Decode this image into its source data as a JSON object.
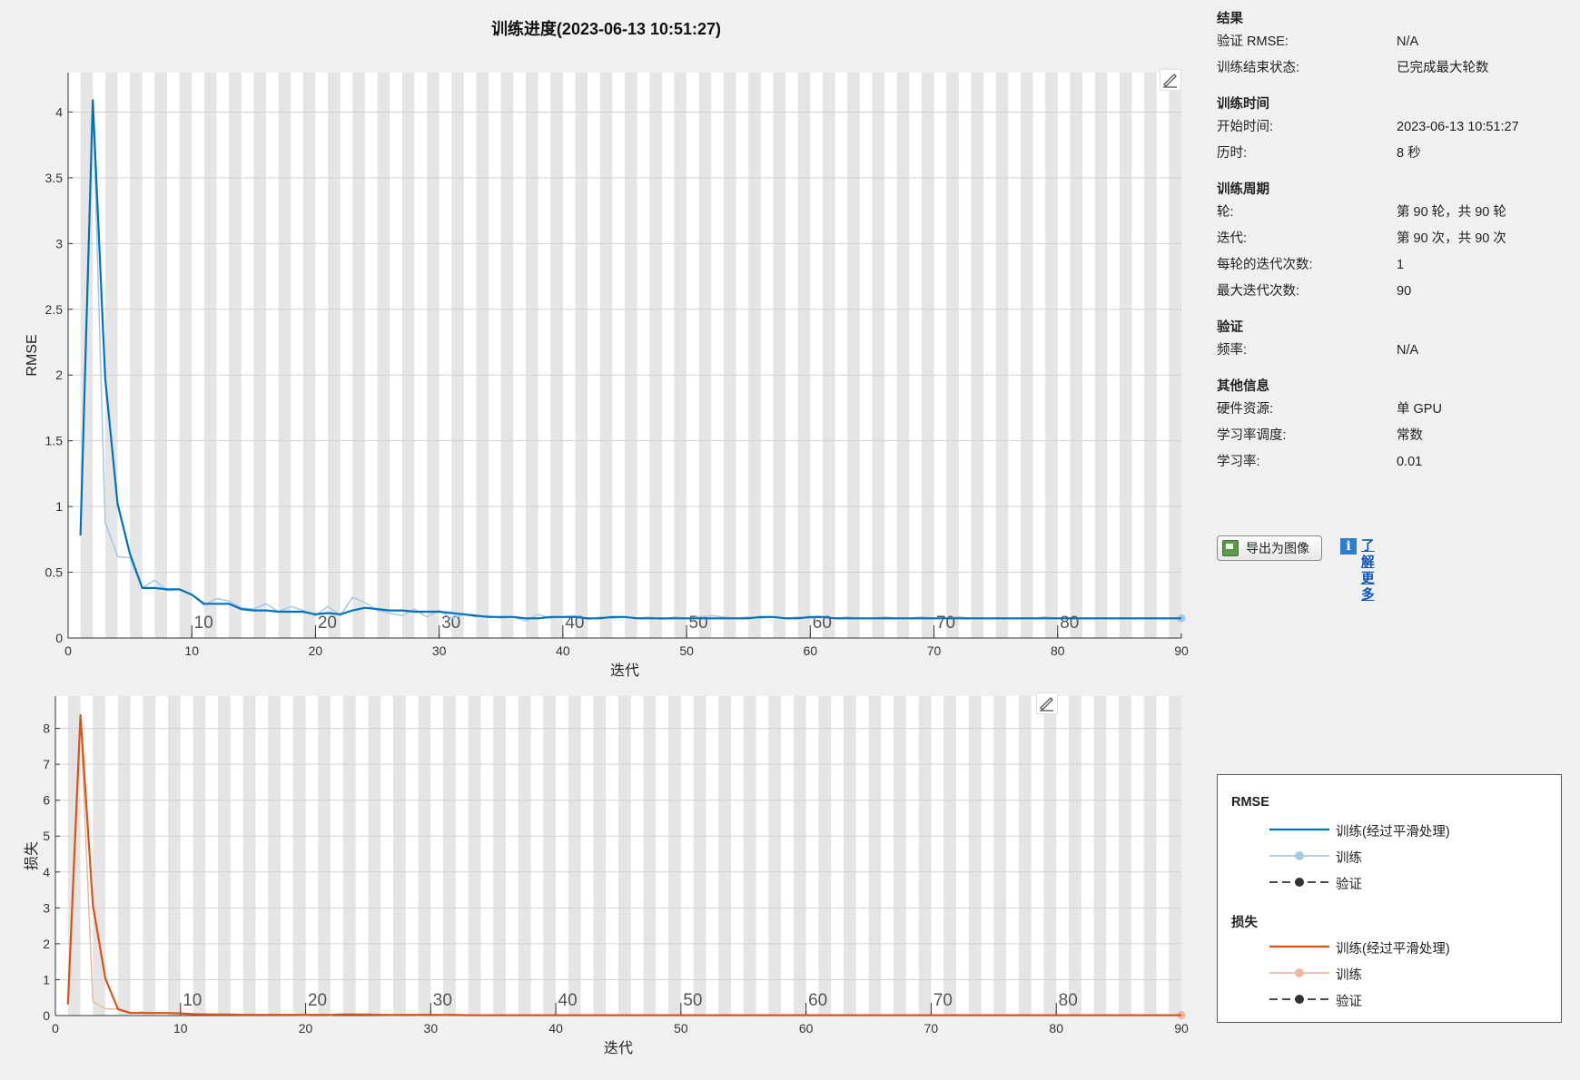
{
  "title": "训练进度(2023-06-13 10:51:27)",
  "colors": {
    "rmse_smoothed": "#0072bd",
    "rmse_raw": "#a6c8e4",
    "loss_smoothed": "#d95319",
    "loss_raw": "#efb8a0",
    "validation": "#333333",
    "stripe": "#e5e5e5"
  },
  "info": {
    "results": {
      "title": "结果",
      "val_rmse_label": "验证 RMSE:",
      "val_rmse": "N/A",
      "end_state_label": "训练结束状态:",
      "end_state": "已完成最大轮数"
    },
    "time": {
      "title": "训练时间",
      "start_label": "开始时间:",
      "start": "2023-06-13 10:51:27",
      "elapsed_label": "历时:",
      "elapsed": "8 秒"
    },
    "cycle": {
      "title": "训练周期",
      "epoch_label": "轮:",
      "epoch": "第 90 轮，共 90 轮",
      "iter_label": "迭代:",
      "iter": "第 90 次，共 90 次",
      "iter_per_epoch_label": "每轮的迭代次数:",
      "iter_per_epoch": "1",
      "max_iter_label": "最大迭代次数:",
      "max_iter": "90"
    },
    "validation": {
      "title": "验证",
      "freq_label": "频率:",
      "freq": "N/A"
    },
    "other": {
      "title": "其他信息",
      "hw_label": "硬件资源:",
      "hw": "单 GPU",
      "lr_sched_label": "学习率调度:",
      "lr_sched": "常数",
      "lr_label": "学习率:",
      "lr": "0.01"
    }
  },
  "actions": {
    "export_label": "导出为图像",
    "learn_more_label": "了解更多",
    "info_icon": "i"
  },
  "legend": {
    "rmse_title": "RMSE",
    "loss_title": "损失",
    "smoothed": "训练(经过平滑处理)",
    "training": "训练",
    "validation": "验证"
  },
  "chart_data": [
    {
      "type": "line",
      "ylabel": "RMSE",
      "xlabel": "迭代",
      "xlim": [
        0,
        90
      ],
      "ylim": [
        0,
        4.3
      ],
      "xticks": [
        0,
        10,
        20,
        30,
        40,
        50,
        60,
        70,
        80,
        90
      ],
      "yticks": [
        0,
        0.5,
        1,
        1.5,
        2,
        2.5,
        3,
        3.5,
        4
      ],
      "ytick_labels": [
        "0",
        "0.5",
        "1",
        "1.5",
        "2",
        "2.5",
        "3",
        "3.5",
        "4"
      ],
      "epoch_labels": [
        "10",
        "20",
        "30",
        "40",
        "50",
        "60",
        "70",
        "80"
      ],
      "grid": true,
      "series": [
        {
          "name": "训练",
          "x": [
            1,
            2,
            3,
            4,
            5,
            6,
            7,
            8,
            9,
            10,
            11,
            12,
            13,
            14,
            15,
            16,
            17,
            18,
            19,
            20,
            21,
            22,
            23,
            24,
            25,
            26,
            27,
            28,
            29,
            30,
            31,
            32,
            33,
            34,
            35,
            36,
            37,
            38,
            39,
            40,
            41,
            42,
            43,
            44,
            45,
            46,
            47,
            48,
            49,
            50,
            51,
            52,
            53,
            54,
            55,
            56,
            57,
            58,
            59,
            60,
            61,
            62,
            63,
            64,
            65,
            66,
            67,
            68,
            69,
            70,
            71,
            72,
            73,
            74,
            75,
            76,
            77,
            78,
            79,
            80,
            81,
            82,
            83,
            84,
            85,
            86,
            87,
            88,
            89,
            90
          ],
          "values": [
            0.78,
            4.09,
            0.88,
            0.62,
            0.61,
            0.38,
            0.44,
            0.36,
            0.37,
            0.33,
            0.25,
            0.3,
            0.28,
            0.23,
            0.22,
            0.26,
            0.2,
            0.24,
            0.21,
            0.17,
            0.24,
            0.17,
            0.31,
            0.27,
            0.21,
            0.19,
            0.17,
            0.22,
            0.16,
            0.21,
            0.15,
            0.18,
            0.16,
            0.17,
            0.15,
            0.16,
            0.13,
            0.18,
            0.15,
            0.16,
            0.17,
            0.14,
            0.16,
            0.15,
            0.16,
            0.15,
            0.16,
            0.14,
            0.16,
            0.15,
            0.16,
            0.17,
            0.16,
            0.15,
            0.16,
            0.15,
            0.16,
            0.15,
            0.16,
            0.15,
            0.16,
            0.15,
            0.16,
            0.15,
            0.15,
            0.16,
            0.15,
            0.15,
            0.16,
            0.15,
            0.15,
            0.16,
            0.15,
            0.15,
            0.15,
            0.15,
            0.15,
            0.15,
            0.16,
            0.15,
            0.15,
            0.15,
            0.15,
            0.15,
            0.15,
            0.15,
            0.15,
            0.15,
            0.15,
            0.15
          ]
        },
        {
          "name": "训练(经过平滑处理)",
          "x": [
            1,
            2,
            3,
            4,
            5,
            6,
            7,
            8,
            9,
            10,
            11,
            12,
            13,
            14,
            15,
            16,
            17,
            18,
            19,
            20,
            21,
            22,
            23,
            24,
            25,
            26,
            27,
            28,
            29,
            30,
            31,
            32,
            33,
            34,
            35,
            36,
            37,
            38,
            39,
            40,
            41,
            42,
            43,
            44,
            45,
            46,
            47,
            48,
            49,
            50,
            51,
            52,
            53,
            54,
            55,
            56,
            57,
            58,
            59,
            60,
            61,
            62,
            63,
            64,
            65,
            66,
            67,
            68,
            69,
            70,
            71,
            72,
            73,
            74,
            75,
            76,
            77,
            78,
            79,
            80,
            81,
            82,
            83,
            84,
            85,
            86,
            87,
            88,
            89,
            90
          ],
          "values": [
            0.78,
            4.09,
            1.97,
            1.02,
            0.64,
            0.38,
            0.38,
            0.37,
            0.37,
            0.33,
            0.26,
            0.26,
            0.26,
            0.22,
            0.21,
            0.21,
            0.2,
            0.2,
            0.2,
            0.18,
            0.19,
            0.18,
            0.21,
            0.23,
            0.22,
            0.21,
            0.21,
            0.2,
            0.2,
            0.2,
            0.19,
            0.18,
            0.17,
            0.16,
            0.16,
            0.16,
            0.15,
            0.15,
            0.16,
            0.16,
            0.16,
            0.15,
            0.15,
            0.16,
            0.16,
            0.15,
            0.15,
            0.15,
            0.15,
            0.15,
            0.15,
            0.15,
            0.15,
            0.15,
            0.15,
            0.16,
            0.16,
            0.15,
            0.15,
            0.16,
            0.16,
            0.15,
            0.15,
            0.15,
            0.15,
            0.15,
            0.15,
            0.15,
            0.15,
            0.15,
            0.15,
            0.15,
            0.15,
            0.15,
            0.15,
            0.15,
            0.15,
            0.15,
            0.15,
            0.15,
            0.15,
            0.15,
            0.15,
            0.15,
            0.15,
            0.15,
            0.15,
            0.15,
            0.15,
            0.15
          ]
        }
      ]
    },
    {
      "type": "line",
      "ylabel": "损失",
      "xlabel": "迭代",
      "xlim": [
        0,
        90
      ],
      "ylim": [
        0,
        8.9
      ],
      "xticks": [
        0,
        10,
        20,
        30,
        40,
        50,
        60,
        70,
        80,
        90
      ],
      "yticks": [
        0,
        1,
        2,
        3,
        4,
        5,
        6,
        7,
        8
      ],
      "ytick_labels": [
        "0",
        "1",
        "2",
        "3",
        "4",
        "5",
        "6",
        "7",
        "8"
      ],
      "epoch_labels": [
        "10",
        "20",
        "30",
        "40",
        "50",
        "60",
        "70",
        "80"
      ],
      "grid": true,
      "series": [
        {
          "name": "训练",
          "x": [
            1,
            2,
            3,
            4,
            5,
            6,
            7,
            8,
            9,
            10,
            11,
            12,
            13,
            14,
            15,
            16,
            17,
            18,
            19,
            20,
            21,
            22,
            23,
            24,
            25,
            26,
            27,
            28,
            29,
            30,
            31,
            32,
            33,
            34,
            35,
            36,
            37,
            38,
            39,
            40,
            41,
            42,
            43,
            44,
            45,
            46,
            47,
            48,
            49,
            50,
            51,
            52,
            53,
            54,
            55,
            56,
            57,
            58,
            59,
            60,
            61,
            62,
            63,
            64,
            65,
            66,
            67,
            68,
            69,
            70,
            71,
            72,
            73,
            74,
            75,
            76,
            77,
            78,
            79,
            80,
            81,
            82,
            83,
            84,
            85,
            86,
            87,
            88,
            89,
            90
          ],
          "values": [
            0.31,
            8.37,
            0.39,
            0.19,
            0.18,
            0.07,
            0.1,
            0.07,
            0.07,
            0.05,
            0.03,
            0.05,
            0.04,
            0.03,
            0.02,
            0.03,
            0.02,
            0.03,
            0.02,
            0.01,
            0.03,
            0.01,
            0.05,
            0.04,
            0.02,
            0.02,
            0.01,
            0.02,
            0.01,
            0.02,
            0.01,
            0.02,
            0.01,
            0.01,
            0.01,
            0.01,
            0.01,
            0.02,
            0.01,
            0.01,
            0.01,
            0.01,
            0.01,
            0.01,
            0.01,
            0.01,
            0.01,
            0.01,
            0.01,
            0.01,
            0.01,
            0.01,
            0.01,
            0.01,
            0.01,
            0.01,
            0.01,
            0.01,
            0.01,
            0.01,
            0.01,
            0.01,
            0.01,
            0.01,
            0.01,
            0.01,
            0.01,
            0.01,
            0.01,
            0.01,
            0.01,
            0.01,
            0.01,
            0.01,
            0.01,
            0.01,
            0.01,
            0.01,
            0.01,
            0.01,
            0.01,
            0.01,
            0.01,
            0.01,
            0.01,
            0.01,
            0.01,
            0.01,
            0.01,
            0.01
          ]
        },
        {
          "name": "训练(经过平滑处理)",
          "x": [
            1,
            2,
            3,
            4,
            5,
            6,
            7,
            8,
            9,
            10,
            11,
            12,
            13,
            14,
            15,
            16,
            17,
            18,
            19,
            20,
            21,
            22,
            23,
            24,
            25,
            26,
            27,
            28,
            29,
            30,
            31,
            32,
            33,
            34,
            35,
            36,
            37,
            38,
            39,
            40,
            41,
            42,
            43,
            44,
            45,
            46,
            47,
            48,
            49,
            50,
            51,
            52,
            53,
            54,
            55,
            56,
            57,
            58,
            59,
            60,
            61,
            62,
            63,
            64,
            65,
            66,
            67,
            68,
            69,
            70,
            71,
            72,
            73,
            74,
            75,
            76,
            77,
            78,
            79,
            80,
            81,
            82,
            83,
            84,
            85,
            86,
            87,
            88,
            89,
            90
          ],
          "values": [
            0.31,
            8.37,
            3.07,
            1.03,
            0.18,
            0.07,
            0.07,
            0.07,
            0.07,
            0.06,
            0.04,
            0.03,
            0.03,
            0.03,
            0.02,
            0.02,
            0.02,
            0.02,
            0.02,
            0.02,
            0.02,
            0.02,
            0.03,
            0.03,
            0.03,
            0.02,
            0.02,
            0.02,
            0.02,
            0.02,
            0.02,
            0.02,
            0.01,
            0.01,
            0.01,
            0.01,
            0.01,
            0.01,
            0.01,
            0.01,
            0.01,
            0.01,
            0.01,
            0.01,
            0.01,
            0.01,
            0.01,
            0.01,
            0.01,
            0.01,
            0.01,
            0.01,
            0.01,
            0.01,
            0.01,
            0.01,
            0.01,
            0.01,
            0.01,
            0.01,
            0.01,
            0.01,
            0.01,
            0.01,
            0.01,
            0.01,
            0.01,
            0.01,
            0.01,
            0.01,
            0.01,
            0.01,
            0.01,
            0.01,
            0.01,
            0.01,
            0.01,
            0.01,
            0.01,
            0.01,
            0.01,
            0.01,
            0.01,
            0.01,
            0.01,
            0.01,
            0.01,
            0.01,
            0.01,
            0.01
          ]
        }
      ]
    }
  ]
}
